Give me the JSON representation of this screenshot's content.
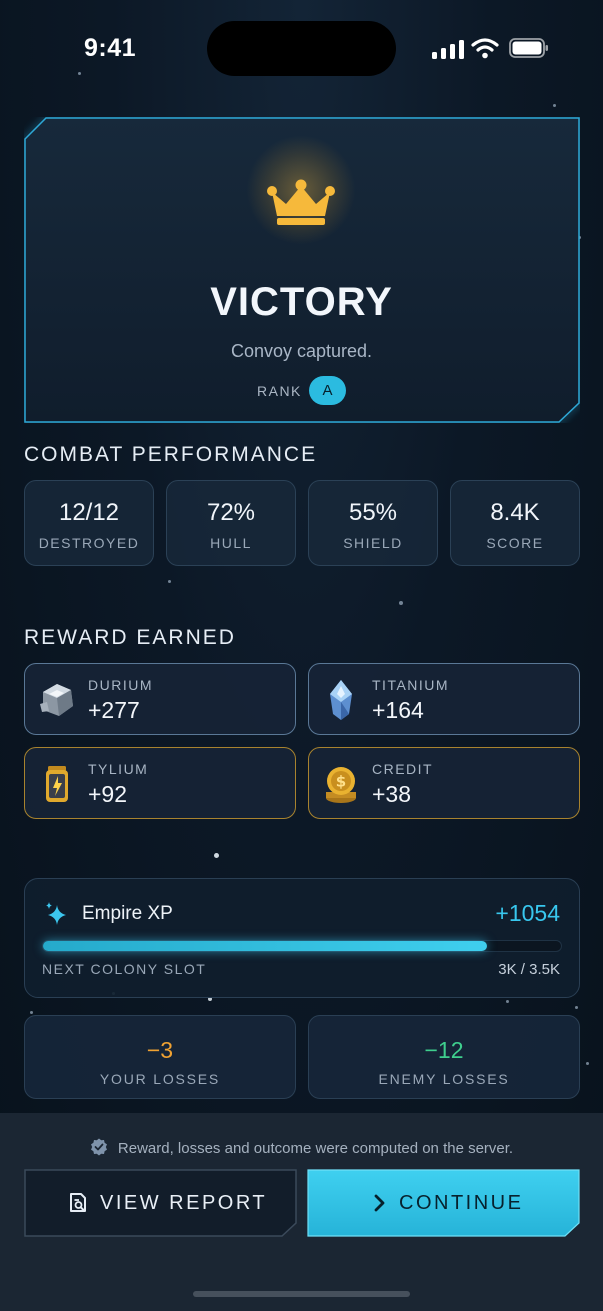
{
  "status_bar": {
    "time": "9:41"
  },
  "hero": {
    "title": "VICTORY",
    "subtitle": "Convoy captured.",
    "rank_label": "RANK",
    "rank_value": "A",
    "icon": "crown-icon"
  },
  "combat": {
    "title": "COMBAT PERFORMANCE",
    "stats": [
      {
        "value": "12/12",
        "label": "DESTROYED"
      },
      {
        "value": "72%",
        "label": "HULL"
      },
      {
        "value": "55%",
        "label": "SHIELD"
      },
      {
        "value": "8.4K",
        "label": "SCORE"
      }
    ]
  },
  "rewards": {
    "title": "REWARD EARNED",
    "items": [
      {
        "name": "DURIUM",
        "amount": "+277",
        "icon": "durium-ore-icon"
      },
      {
        "name": "TITANIUM",
        "amount": "+164",
        "icon": "titanium-crystal-icon"
      },
      {
        "name": "TYLIUM",
        "amount": "+92",
        "icon": "tylium-canister-icon"
      },
      {
        "name": "CREDIT",
        "amount": "+38",
        "icon": "credit-coin-icon"
      }
    ]
  },
  "xp": {
    "title": "Empire XP",
    "gain": "+1054",
    "progress_label": "NEXT COLONY SLOT",
    "progress_text": "3K / 3.5K",
    "progress_fraction": 0.857,
    "icon": "sparkle-icon"
  },
  "losses": [
    {
      "value": "−3",
      "label": "YOUR LOSSES",
      "color": "#f0a232"
    },
    {
      "value": "−12",
      "label": "ENEMY LOSSES",
      "color": "#3fcf8e"
    }
  ],
  "footer": {
    "server_note": "Reward, losses and outcome were computed on the server.",
    "view_report_label": "VIEW REPORT",
    "continue_label": "CONTINUE"
  },
  "colors": {
    "accent": "#2bbbe0",
    "gold": "#f5b83a",
    "background": "#0c1826"
  }
}
